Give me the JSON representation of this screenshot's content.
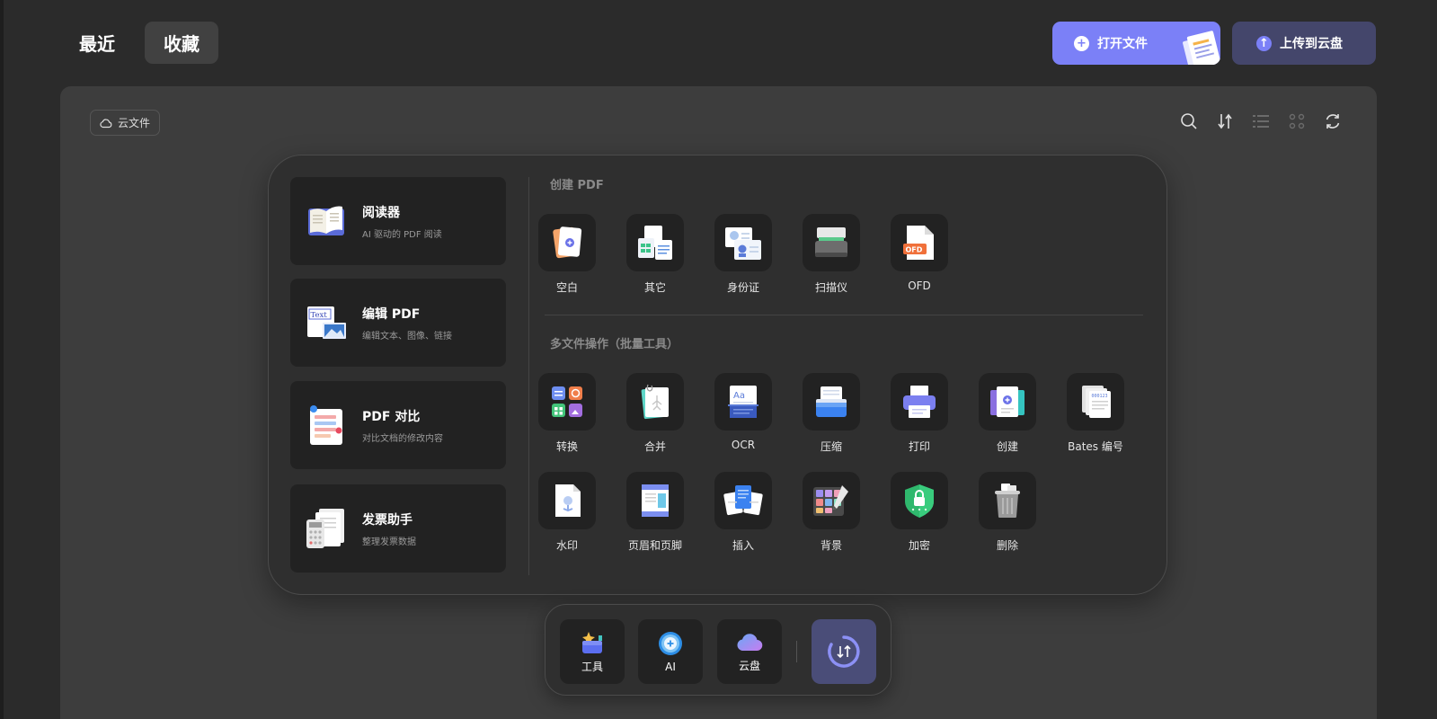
{
  "tabs": {
    "recent": "最近",
    "favorites": "收藏"
  },
  "buttons": {
    "open_file": "打开文件",
    "upload_cloud": "上传到云盘"
  },
  "panel": {
    "cloud_chip": "云文件"
  },
  "features": [
    {
      "title": "阅读器",
      "subtitle": "AI 驱动的 PDF 阅读"
    },
    {
      "title": "编辑 PDF",
      "subtitle": "编辑文本、图像、链接"
    },
    {
      "title": "PDF 对比",
      "subtitle": "对比文档的修改内容"
    },
    {
      "title": "发票助手",
      "subtitle": "整理发票数据"
    }
  ],
  "edit_icon_text": "Text",
  "sections": {
    "create": "创建 PDF",
    "batch": "多文件操作（批量工具）"
  },
  "create_tools": [
    "空白",
    "其它",
    "身份证",
    "扫描仪",
    "OFD"
  ],
  "ofd_badge": "OFD",
  "batch_tools": [
    "转换",
    "合并",
    "OCR",
    "压缩",
    "打印",
    "创建",
    "Bates 编号",
    "水印",
    "页眉和页脚",
    "插入",
    "背景",
    "加密",
    "删除"
  ],
  "dock": {
    "tools": "工具",
    "ai": "AI",
    "cloud": "云盘"
  },
  "colors": {
    "accent": "#7b80f7",
    "upload_bg": "#44466b",
    "panel_bg": "#3d3d3d",
    "popup_bg": "#2f2f2f",
    "card_bg": "#222222"
  }
}
